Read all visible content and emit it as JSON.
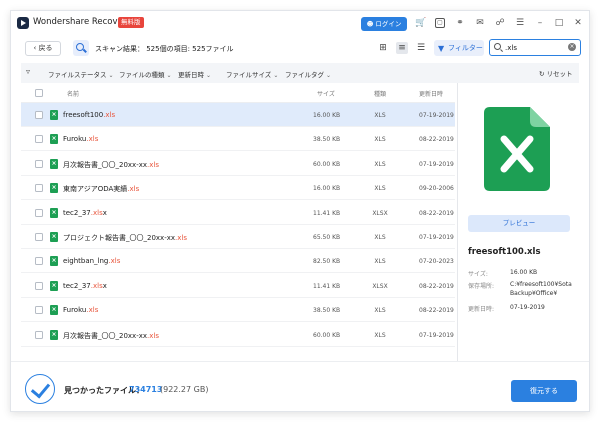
{
  "app": {
    "title": "Wondershare Recoverit",
    "badge": "無料版",
    "login_label": "ログイン"
  },
  "titlebar_icons": [
    "cart-icon",
    "gift-icon",
    "headset-icon",
    "mail-icon",
    "settings-icon",
    "menu-icon",
    "minimize-icon",
    "maximize-icon",
    "close-icon"
  ],
  "toolbar": {
    "back_label": "戻る",
    "scan_result": "スキャン結果： 525個の項目: 525ファイル",
    "filter_label": "フィルター"
  },
  "search": {
    "value": ".xls"
  },
  "filters": {
    "items": [
      "ファイルステータス",
      "ファイルの種類",
      "更新日時",
      "ファイルサイズ",
      "ファイルタグ"
    ],
    "reset_label": "リセット"
  },
  "table": {
    "headers": {
      "name": "名前",
      "size": "サイズ",
      "type": "種類",
      "date": "更新日時"
    },
    "rows": [
      {
        "base": "freesoft100",
        "ext": ".xls",
        "size": "16.00 KB",
        "type": "XLS",
        "date": "07-19-2019",
        "selected": true
      },
      {
        "base": "Furoku",
        "ext": ".xls",
        "size": "38.50 KB",
        "type": "XLS",
        "date": "08-22-2019",
        "selected": false
      },
      {
        "base": "月次報告書_〇〇_20xx-xx",
        "ext": ".xls",
        "size": "60.00 KB",
        "type": "XLS",
        "date": "07-19-2019",
        "selected": false
      },
      {
        "base": "東南アジアODA実績",
        "ext": ".xls",
        "size": "16.00 KB",
        "type": "XLS",
        "date": "09-20-2006",
        "selected": false
      },
      {
        "base": "tec2_37",
        "ext": ".xls",
        "ext2": "x",
        "size": "11.41 KB",
        "type": "XLSX",
        "date": "08-22-2019",
        "selected": false
      },
      {
        "base": "プロジェクト報告書_〇〇_20xx-xx",
        "ext": ".xls",
        "size": "65.50 KB",
        "type": "XLS",
        "date": "07-19-2019",
        "selected": false
      },
      {
        "base": "eightban_lng",
        "ext": ".xls",
        "size": "82.50 KB",
        "type": "XLS",
        "date": "07-20-2023",
        "selected": false
      },
      {
        "base": "tec2_37",
        "ext": ".xls",
        "ext2": "x",
        "size": "11.41 KB",
        "type": "XLSX",
        "date": "08-22-2019",
        "selected": false
      },
      {
        "base": "Furoku",
        "ext": ".xls",
        "size": "38.50 KB",
        "type": "XLS",
        "date": "08-22-2019",
        "selected": false
      },
      {
        "base": "月次報告書_〇〇_20xx-xx",
        "ext": ".xls",
        "size": "60.00 KB",
        "type": "XLS",
        "date": "07-19-2019",
        "selected": false
      }
    ]
  },
  "preview": {
    "button_label": "プレビュー",
    "file_name": "freesoft100.xls",
    "size_label": "サイズ:",
    "size_value": "16.00 KB",
    "location_label": "保存場所:",
    "location_value": "C:¥freesoft100¥Sota Backup¥Office¥",
    "date_label": "更新日時:",
    "date_value": "07-19-2019"
  },
  "footer": {
    "found_label": "見つかったファイル：",
    "found_count": "734713",
    "found_size": "(922.27 GB)",
    "recover_label": "復元する"
  },
  "colors": {
    "accent": "#2b80e0",
    "excel_green": "#1d9f54",
    "extension": "#e8553c",
    "selected_row": "#e0ebfb"
  }
}
